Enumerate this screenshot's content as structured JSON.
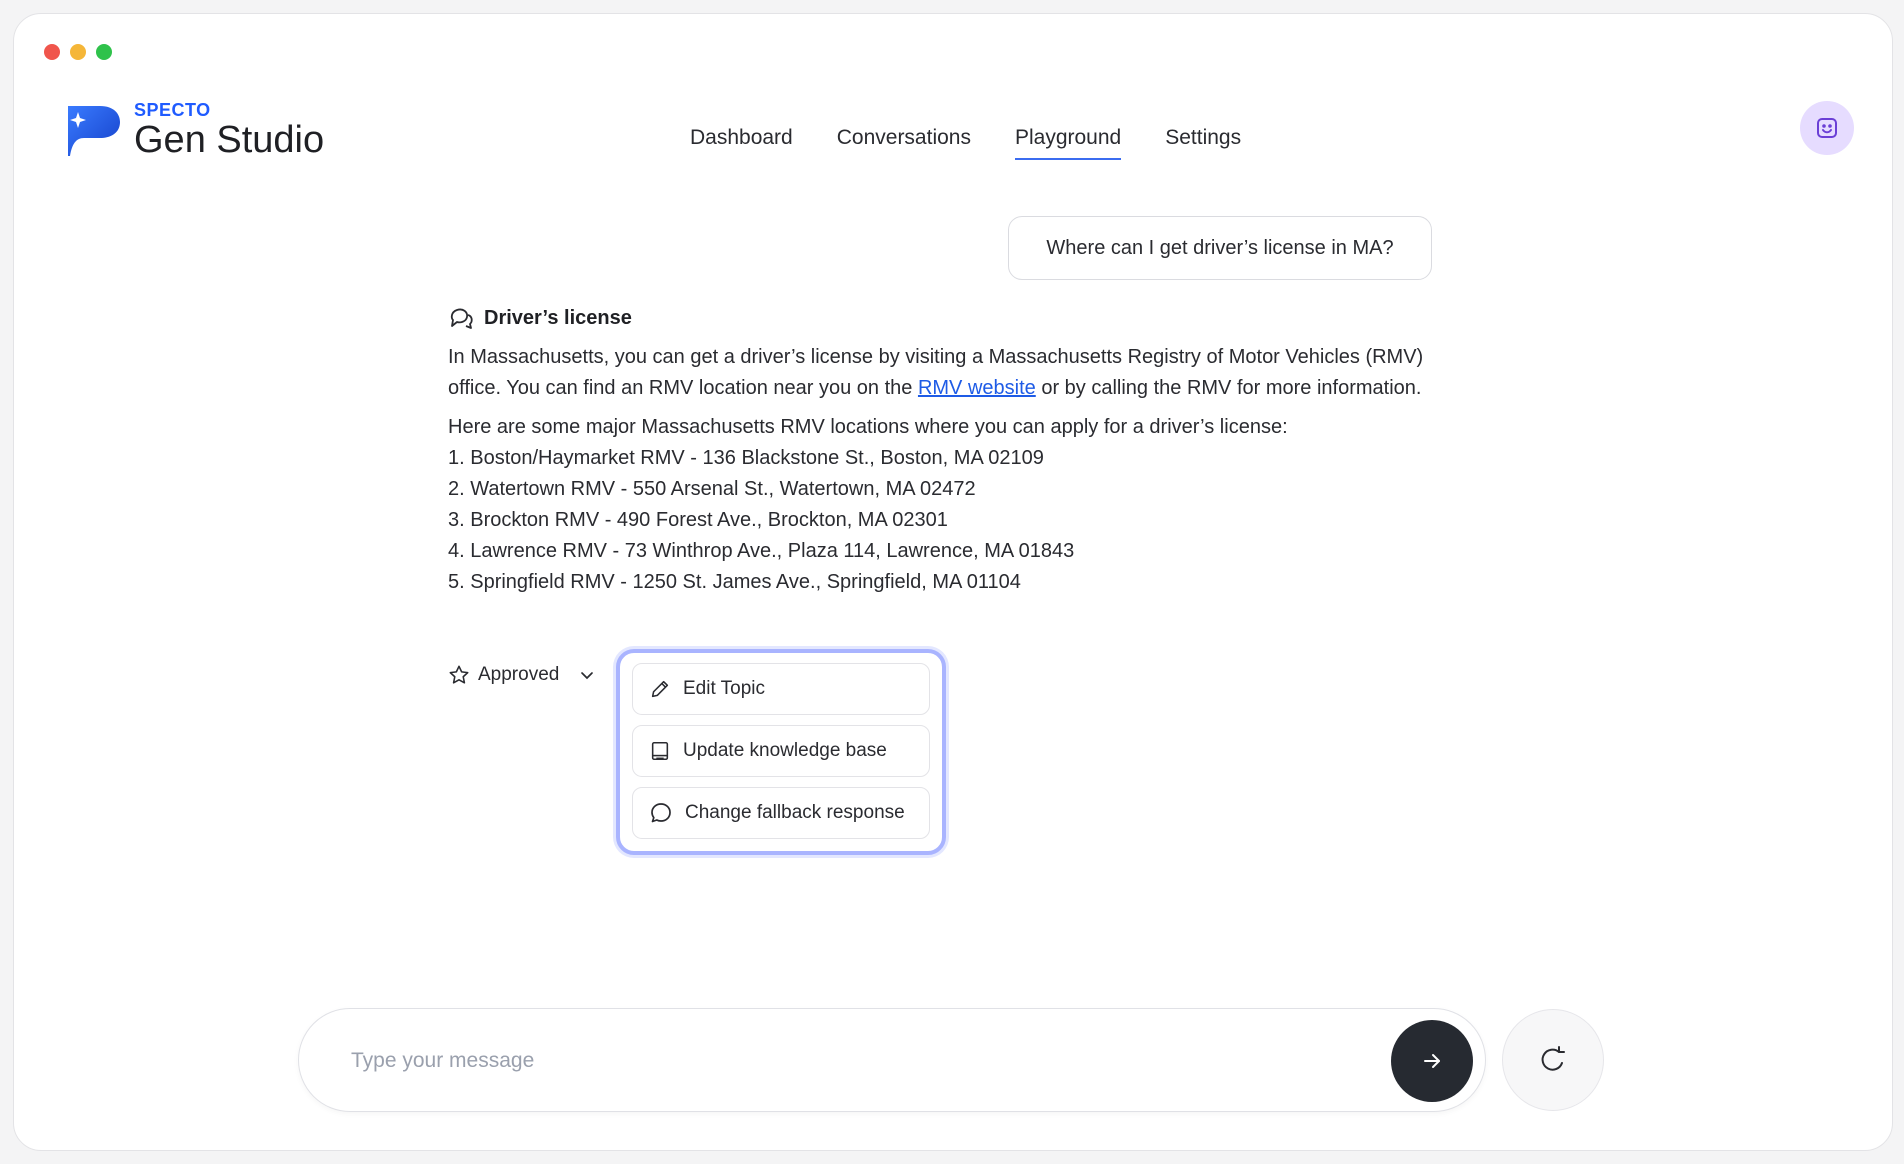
{
  "app": {
    "brand": "SPECTO",
    "product": "Gen Studio"
  },
  "nav": {
    "items": [
      {
        "label": "Dashboard"
      },
      {
        "label": "Conversations"
      },
      {
        "label": "Playground",
        "active": true
      },
      {
        "label": "Settings"
      }
    ]
  },
  "chat": {
    "user_message": "Where can I get driver’s license in MA?",
    "topic_title": "Driver’s license",
    "answer_intro_before_link": "In Massachusetts, you can get a driver’s license by visiting a Massachusetts Registry of Motor Vehicles (RMV) office. You can find an RMV location near you on the ",
    "answer_link_text": "RMV website",
    "answer_intro_after_link": " or by calling the RMV for more information.",
    "answer_list_intro": "Here are some major Massachusetts RMV locations where you can apply for a driver’s license:",
    "locations": [
      "1. Boston/Haymarket RMV - 136 Blackstone St., Boston, MA 02109",
      "2. Watertown RMV - 550 Arsenal St., Watertown, MA 02472",
      "3. Brockton RMV - 490 Forest Ave., Brockton, MA 02301",
      "4. Lawrence RMV - 73 Winthrop Ave., Plaza 114, Lawrence, MA 01843",
      "5. Springfield RMV - 1250 St. James Ave., Springfield, MA 01104"
    ],
    "status_label": "Approved"
  },
  "actions_menu": {
    "items": [
      {
        "label": "Edit Topic",
        "icon": "pencil-icon"
      },
      {
        "label": "Update knowledge base",
        "icon": "book-icon"
      },
      {
        "label": "Change fallback response",
        "icon": "chat-bubble-icon"
      }
    ]
  },
  "composer": {
    "placeholder": "Type your message",
    "value": ""
  },
  "colors": {
    "accent": "#1f5bff",
    "link": "#1e5be6",
    "popup_border": "#a9b4ff",
    "send_button": "#262a31",
    "avatar_bg": "#e6dcff"
  }
}
